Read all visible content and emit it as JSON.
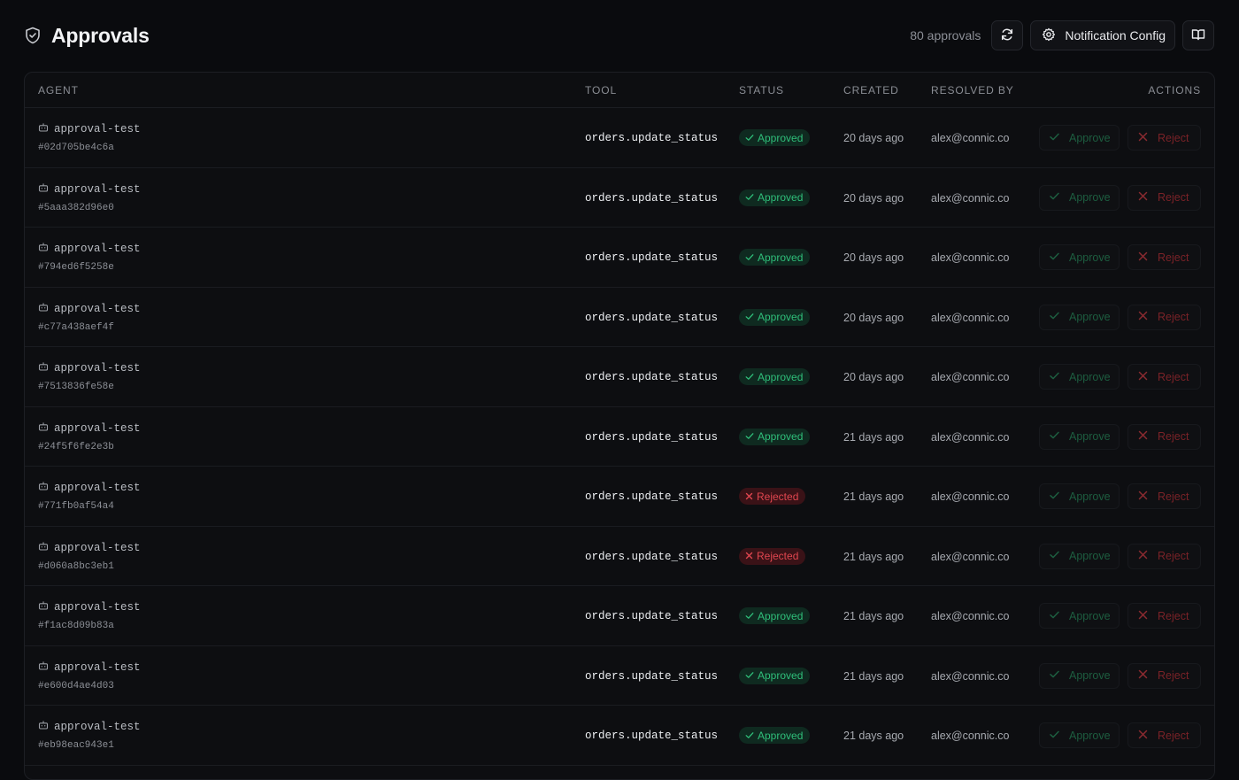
{
  "header": {
    "title": "Approvals",
    "count": "80 approvals",
    "notification_config_label": "Notification Config"
  },
  "table": {
    "columns": [
      "AGENT",
      "TOOL",
      "STATUS",
      "CREATED",
      "RESOLVED BY",
      "ACTIONS"
    ],
    "approve_label": "Approve",
    "reject_label": "Reject",
    "rows": [
      {
        "agent": "approval-test",
        "id": "#02d705be4c6a",
        "tool": "orders.update_status",
        "status": "Approved",
        "created": "20 days ago",
        "resolved_by": "alex@connic.co"
      },
      {
        "agent": "approval-test",
        "id": "#5aaa382d96e0",
        "tool": "orders.update_status",
        "status": "Approved",
        "created": "20 days ago",
        "resolved_by": "alex@connic.co"
      },
      {
        "agent": "approval-test",
        "id": "#794ed6f5258e",
        "tool": "orders.update_status",
        "status": "Approved",
        "created": "20 days ago",
        "resolved_by": "alex@connic.co"
      },
      {
        "agent": "approval-test",
        "id": "#c77a438aef4f",
        "tool": "orders.update_status",
        "status": "Approved",
        "created": "20 days ago",
        "resolved_by": "alex@connic.co"
      },
      {
        "agent": "approval-test",
        "id": "#7513836fe58e",
        "tool": "orders.update_status",
        "status": "Approved",
        "created": "20 days ago",
        "resolved_by": "alex@connic.co"
      },
      {
        "agent": "approval-test",
        "id": "#24f5f6fe2e3b",
        "tool": "orders.update_status",
        "status": "Approved",
        "created": "21 days ago",
        "resolved_by": "alex@connic.co"
      },
      {
        "agent": "approval-test",
        "id": "#771fb0af54a4",
        "tool": "orders.update_status",
        "status": "Rejected",
        "created": "21 days ago",
        "resolved_by": "alex@connic.co"
      },
      {
        "agent": "approval-test",
        "id": "#d060a8bc3eb1",
        "tool": "orders.update_status",
        "status": "Rejected",
        "created": "21 days ago",
        "resolved_by": "alex@connic.co"
      },
      {
        "agent": "approval-test",
        "id": "#f1ac8d09b83a",
        "tool": "orders.update_status",
        "status": "Approved",
        "created": "21 days ago",
        "resolved_by": "alex@connic.co"
      },
      {
        "agent": "approval-test",
        "id": "#e600d4ae4d03",
        "tool": "orders.update_status",
        "status": "Approved",
        "created": "21 days ago",
        "resolved_by": "alex@connic.co"
      },
      {
        "agent": "approval-test",
        "id": "#eb98eac943e1",
        "tool": "orders.update_status",
        "status": "Approved",
        "created": "21 days ago",
        "resolved_by": "alex@connic.co"
      }
    ]
  },
  "colors": {
    "background": "#0a0b0e",
    "approved": "#2fbf7a",
    "rejected": "#e0464f"
  },
  "icons": {
    "title": "shield-check-icon",
    "refresh": "refresh-icon",
    "settings": "gear-icon",
    "docs": "book-open-icon",
    "agent": "robot-icon",
    "approve": "check-icon",
    "reject": "x-icon"
  }
}
